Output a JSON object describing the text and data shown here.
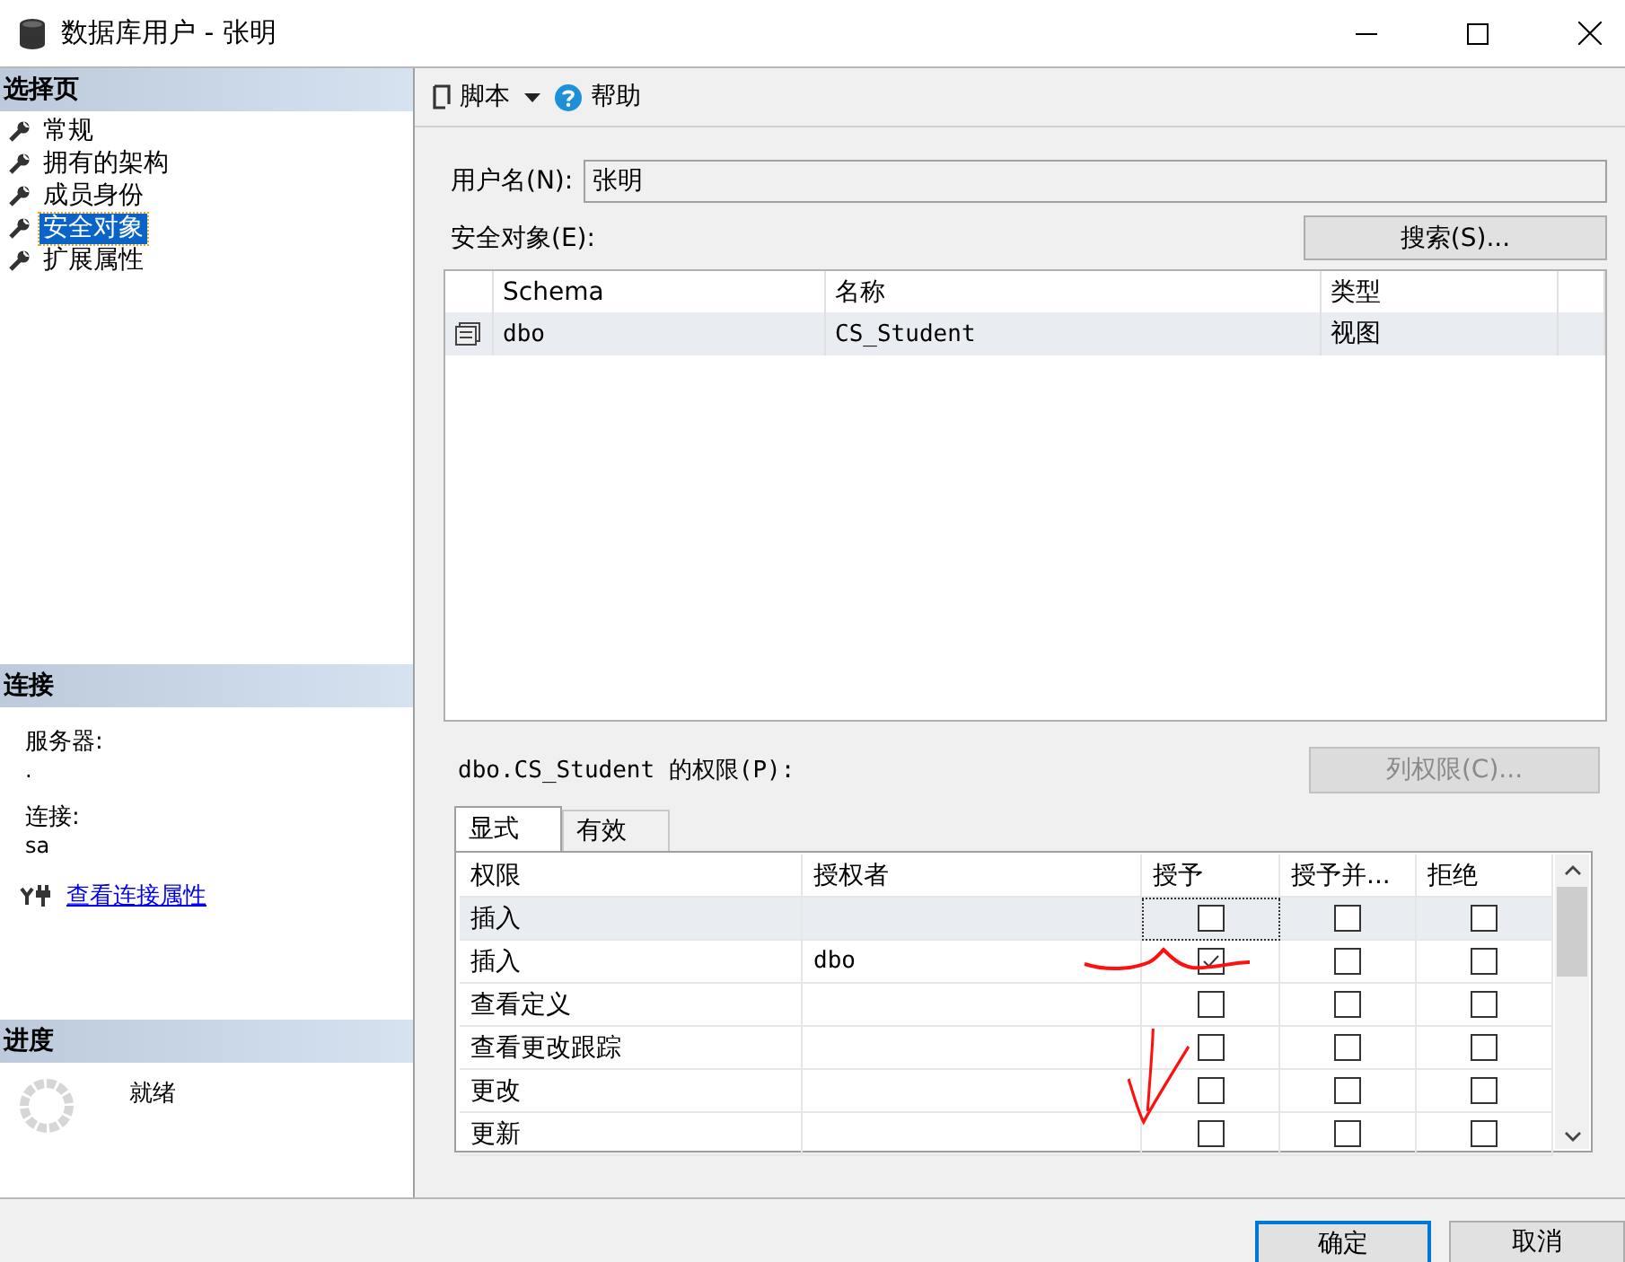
{
  "window": {
    "title": "数据库用户 - 张明"
  },
  "sidebar": {
    "header": "选择页",
    "items": [
      {
        "label": "常规",
        "selected": false
      },
      {
        "label": "拥有的架构",
        "selected": false
      },
      {
        "label": "成员身份",
        "selected": false
      },
      {
        "label": "安全对象",
        "selected": true
      },
      {
        "label": "扩展属性",
        "selected": false
      }
    ]
  },
  "connection": {
    "header": "连接",
    "server_label": "服务器:",
    "server_value": ".",
    "connection_label": "连接:",
    "connection_value": "sa",
    "link": "查看连接属性"
  },
  "progress": {
    "header": "进度",
    "status": "就绪"
  },
  "toolbar": {
    "script": "脚本",
    "help": "帮助"
  },
  "user_name": {
    "label": "用户名(N):",
    "value": "张明"
  },
  "securables": {
    "label": "安全对象(E):",
    "search_button": "搜索(S)...",
    "columns": [
      "Schema",
      "名称",
      "类型"
    ],
    "rows": [
      {
        "schema": "dbo",
        "name": "CS_Student",
        "type": "视图",
        "selected": true
      }
    ]
  },
  "permissions": {
    "label": "dbo.CS_Student 的权限(P):",
    "column_button": "列权限(C)...",
    "tabs": [
      {
        "label": "显式",
        "selected": true
      },
      {
        "label": "有效",
        "selected": false
      }
    ],
    "columns": [
      "权限",
      "授权者",
      "授予",
      "授予并...",
      "拒绝"
    ],
    "rows": [
      {
        "permission": "插入",
        "grantor": "",
        "grant": false,
        "with_grant": false,
        "deny": false,
        "selected": true
      },
      {
        "permission": "插入",
        "grantor": "dbo",
        "grant": true,
        "with_grant": false,
        "deny": false,
        "selected": false
      },
      {
        "permission": "查看定义",
        "grantor": "",
        "grant": false,
        "with_grant": false,
        "deny": false,
        "selected": false
      },
      {
        "permission": "查看更改跟踪",
        "grantor": "",
        "grant": false,
        "with_grant": false,
        "deny": false,
        "selected": false
      },
      {
        "permission": "更改",
        "grantor": "",
        "grant": false,
        "with_grant": false,
        "deny": false,
        "selected": false
      },
      {
        "permission": "更新",
        "grantor": "",
        "grant": false,
        "with_grant": false,
        "deny": false,
        "selected": false
      }
    ]
  },
  "annotations": [
    {
      "kind": "underline"
    },
    {
      "kind": "arrow"
    }
  ],
  "buttons": [
    "确定",
    "取消"
  ]
}
